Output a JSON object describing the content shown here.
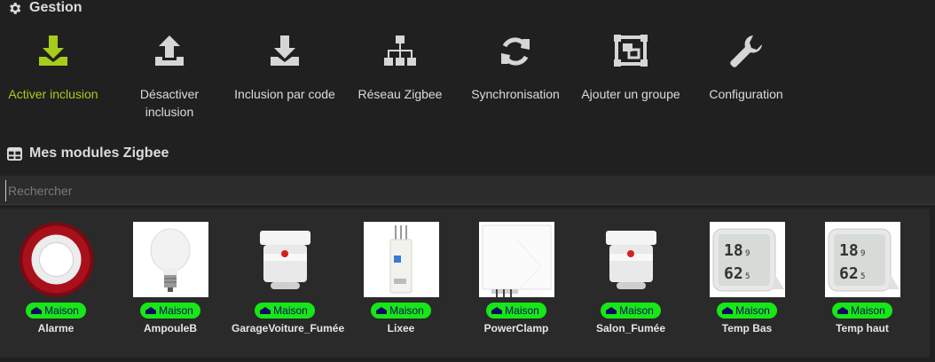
{
  "gestion": {
    "title": "Gestion",
    "icon": "gear-icon",
    "actions": [
      {
        "label": "Activer inclusion",
        "icon": "download-icon",
        "active": true
      },
      {
        "label": "Désactiver inclusion",
        "icon": "upload-icon",
        "active": false
      },
      {
        "label": "Inclusion par code",
        "icon": "download-code-icon",
        "active": false
      },
      {
        "label": "Réseau Zigbee",
        "icon": "sitemap-icon",
        "active": false
      },
      {
        "label": "Synchronisation",
        "icon": "sync-icon",
        "active": false
      },
      {
        "label": "Ajouter un groupe",
        "icon": "object-group-icon",
        "active": false
      },
      {
        "label": "Configuration",
        "icon": "wrench-icon",
        "active": false
      }
    ]
  },
  "modules": {
    "title": "Mes modules Zigbee",
    "icon": "table-icon",
    "search_placeholder": "Rechercher",
    "items": [
      {
        "name": "Alarme",
        "room": "Maison",
        "device": "siren"
      },
      {
        "name": "AmpouleB",
        "room": "Maison",
        "device": "bulb"
      },
      {
        "name": "GarageVoiture_Fumée",
        "room": "Maison",
        "device": "smoke-detector"
      },
      {
        "name": "Lixee",
        "room": "Maison",
        "device": "lixee-module"
      },
      {
        "name": "PowerClamp",
        "room": "Maison",
        "device": "power-clamp"
      },
      {
        "name": "Salon_Fumée",
        "room": "Maison",
        "device": "smoke-detector"
      },
      {
        "name": "Temp Bas",
        "room": "Maison",
        "device": "thermometer",
        "display": {
          "temp": "18",
          "temp_dec": "9",
          "hum": "62",
          "hum_dec": "5"
        }
      },
      {
        "name": "Temp haut",
        "room": "Maison",
        "device": "thermometer",
        "display": {
          "temp": "18",
          "temp_dec": "9",
          "hum": "62",
          "hum_dec": "5"
        }
      }
    ]
  },
  "colors": {
    "accent": "#a6cc1c",
    "badge": "#17e617",
    "background": "#202020"
  }
}
